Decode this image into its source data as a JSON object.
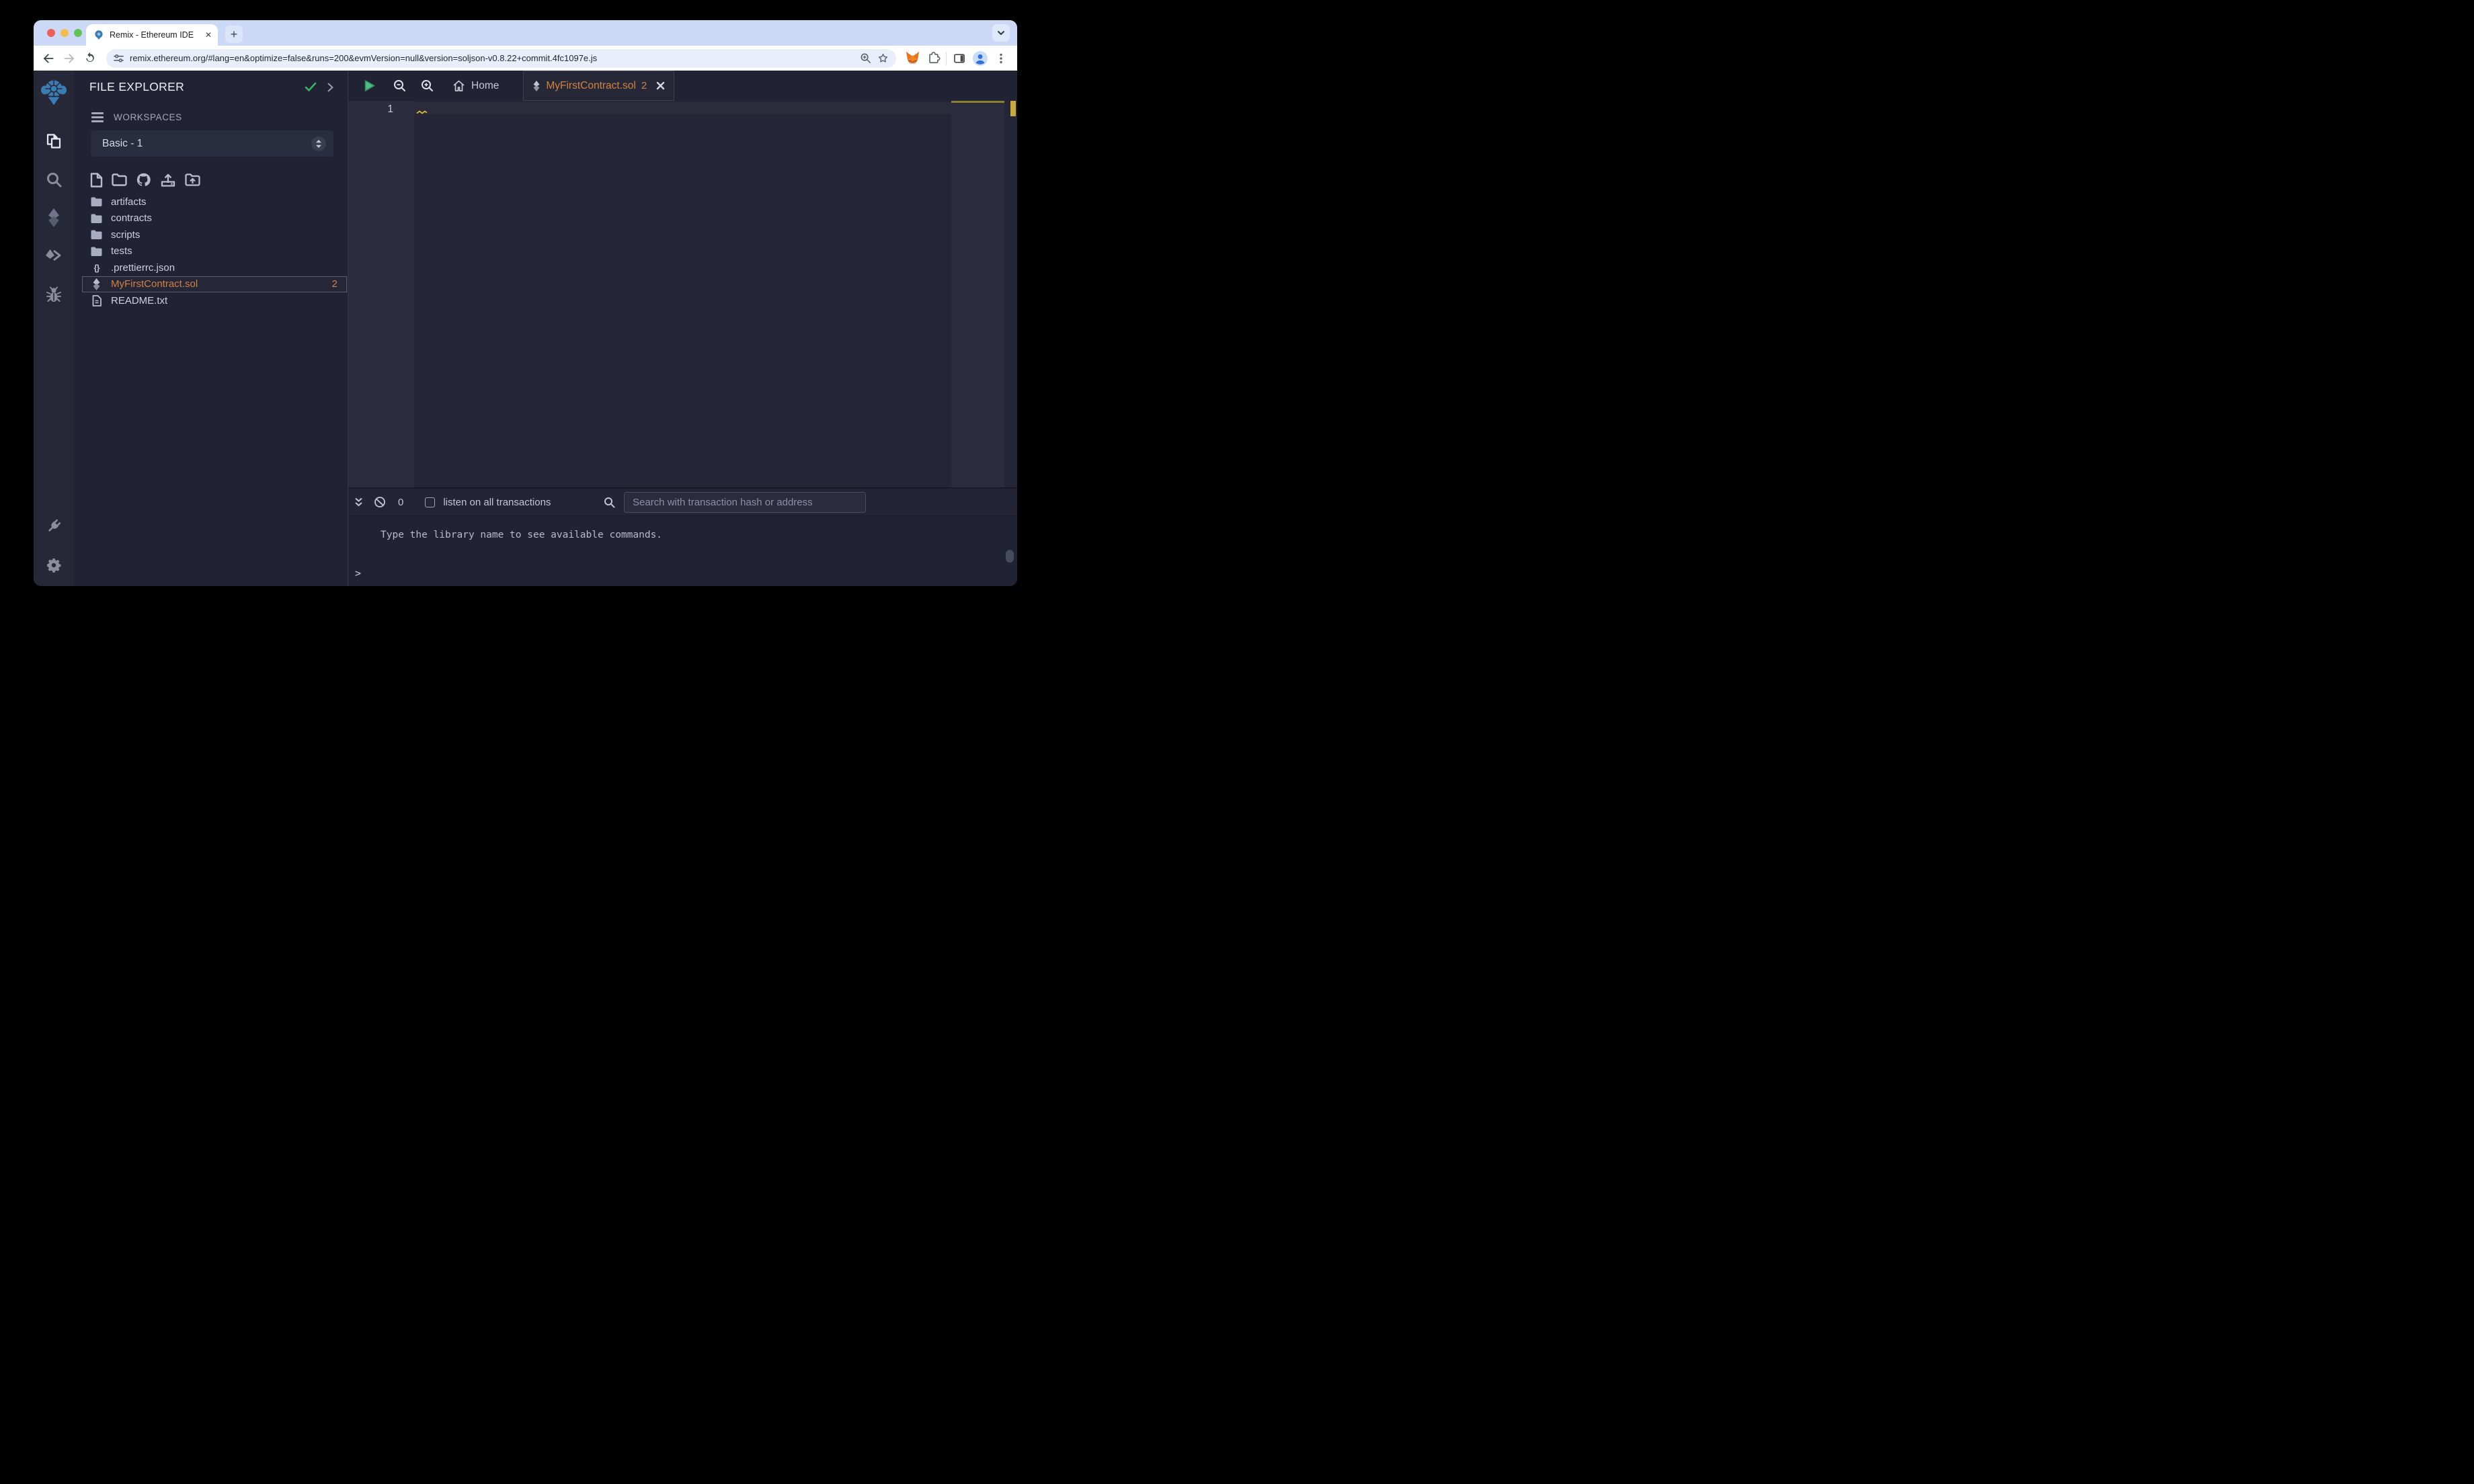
{
  "browser": {
    "tab_title": "Remix - Ethereum IDE",
    "url": "remix.ethereum.org/#lang=en&optimize=false&runs=200&evmVersion=null&version=soljson-v0.8.22+commit.4fc1097e.js",
    "new_tab_label": "+",
    "close_tab_label": "✕"
  },
  "rail": {
    "icon_names": [
      "remix-logo",
      "file-explorer",
      "search",
      "solidity-compiler",
      "deploy-and-run",
      "debugger",
      "plugin-manager",
      "settings"
    ],
    "active_icon": "file-explorer"
  },
  "file_explorer": {
    "title": "FILE EXPLORER",
    "workspaces_label": "WORKSPACES",
    "workspace_name": "Basic - 1",
    "toolbar_icon_names": [
      "new-file",
      "new-folder",
      "github-clone",
      "upload-file",
      "upload-folder"
    ],
    "files": [
      {
        "label": "artifacts",
        "type": "folder"
      },
      {
        "label": "contracts",
        "type": "folder"
      },
      {
        "label": "scripts",
        "type": "folder"
      },
      {
        "label": "tests",
        "type": "folder"
      },
      {
        "label": ".prettierrc.json",
        "type": "json"
      },
      {
        "label": "MyFirstContract.sol",
        "type": "solidity",
        "selected": true,
        "badge": "2"
      },
      {
        "label": "README.txt",
        "type": "file"
      }
    ]
  },
  "editor": {
    "home_tab": "Home",
    "active_tab": {
      "label": "MyFirstContract.sol",
      "badge": "2"
    },
    "line_number": "1"
  },
  "terminal": {
    "pending_count": "0",
    "listen_label": "listen on all transactions",
    "search_placeholder": "Search with transaction hash or address",
    "message": "Type the library name to see available commands.",
    "prompt": ">"
  },
  "icons": {
    "json_glyph": "{}"
  },
  "colors": {
    "accent_orange": "#d3813f",
    "check_green": "#35b56b",
    "play_green": "#52bd87",
    "warning_yellow": "#d9b72e",
    "ruler_marker_gold": "#c9a93a",
    "logo_blue": "#3a7db5",
    "panel_bg": "#212233",
    "rail_bg": "#262838",
    "tabstrip_bg": "#ccd9f6"
  }
}
